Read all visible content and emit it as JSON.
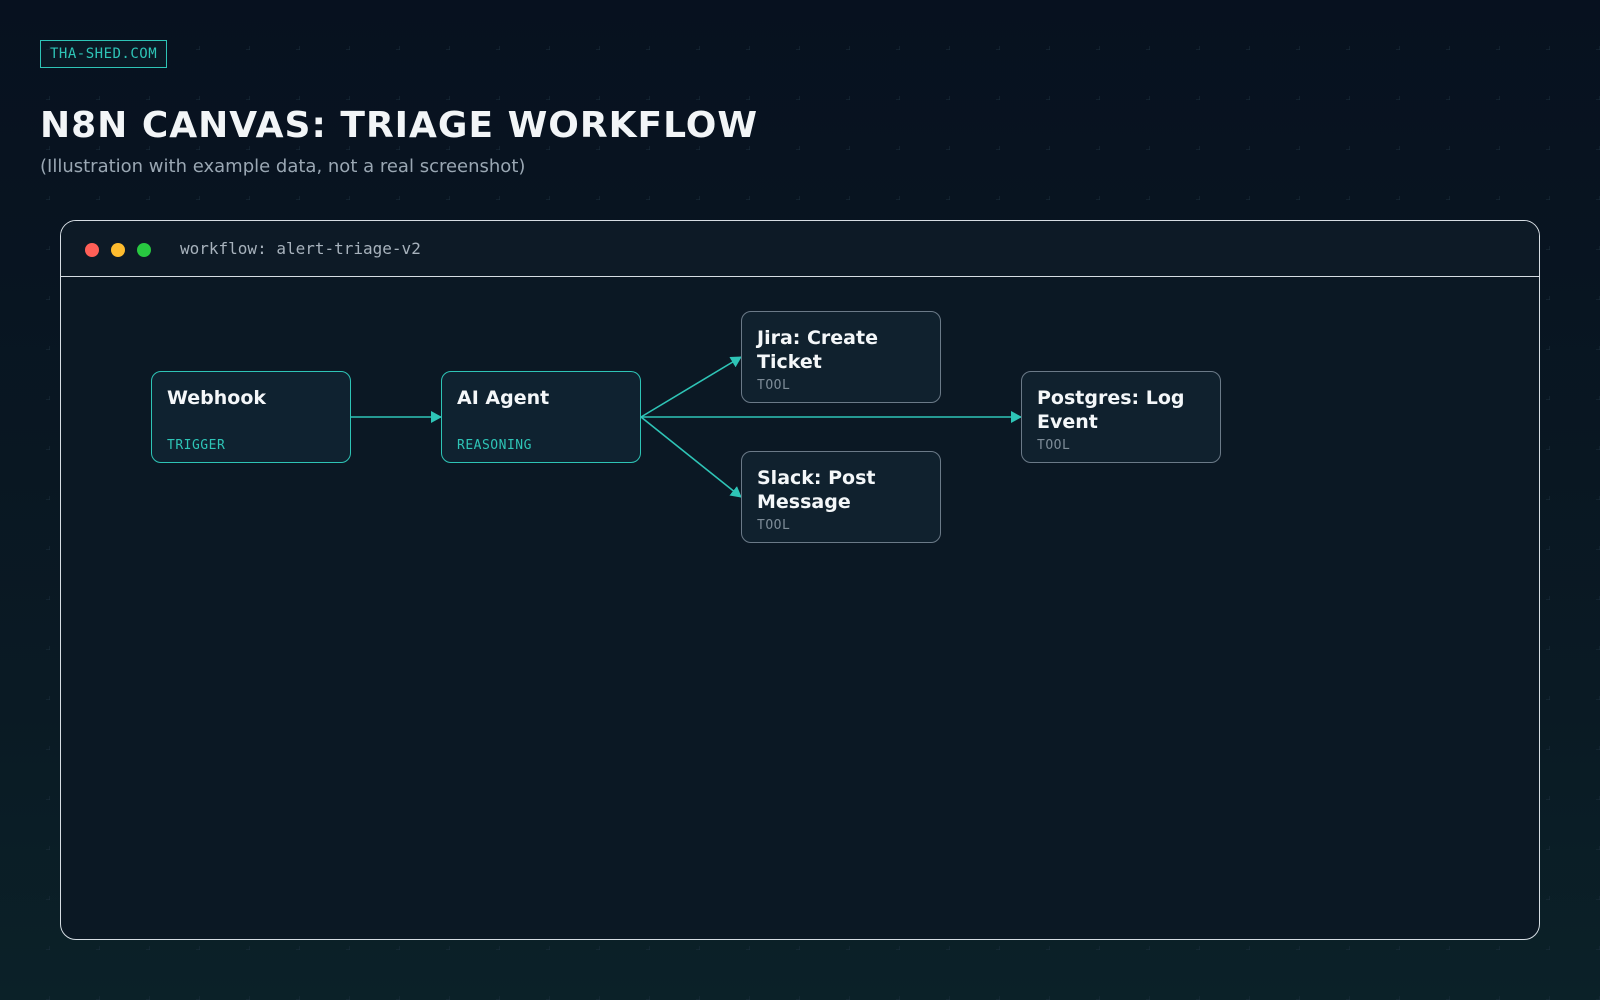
{
  "brand": "THA-SHED.COM",
  "title": "N8N CANVAS: TRIAGE WORKFLOW",
  "subtitle": "(Illustration with example data, not a real screenshot)",
  "window": {
    "title": "workflow: alert-triage-v2",
    "controls": {
      "close_color": "#ff5f57",
      "minimize_color": "#febc2e",
      "maximize_color": "#28c840"
    }
  },
  "colors": {
    "accent": "#2ec4b6",
    "muted_border": "#6b7a88"
  },
  "nodes": [
    {
      "id": "webhook",
      "label": "Webhook",
      "type": "TRIGGER",
      "style": "accent"
    },
    {
      "id": "ai-agent",
      "label": "AI Agent",
      "type": "REASONING",
      "style": "accent"
    },
    {
      "id": "jira",
      "label": "Jira: Create Ticket",
      "type": "TOOL",
      "style": "muted"
    },
    {
      "id": "slack",
      "label": "Slack: Post Message",
      "type": "TOOL",
      "style": "muted"
    },
    {
      "id": "postgres",
      "label": "Postgres: Log Event",
      "type": "TOOL",
      "style": "muted"
    }
  ],
  "connections": [
    {
      "from": "webhook",
      "to": "ai-agent"
    },
    {
      "from": "ai-agent",
      "to": "jira"
    },
    {
      "from": "ai-agent",
      "to": "postgres"
    },
    {
      "from": "ai-agent",
      "to": "slack"
    }
  ]
}
